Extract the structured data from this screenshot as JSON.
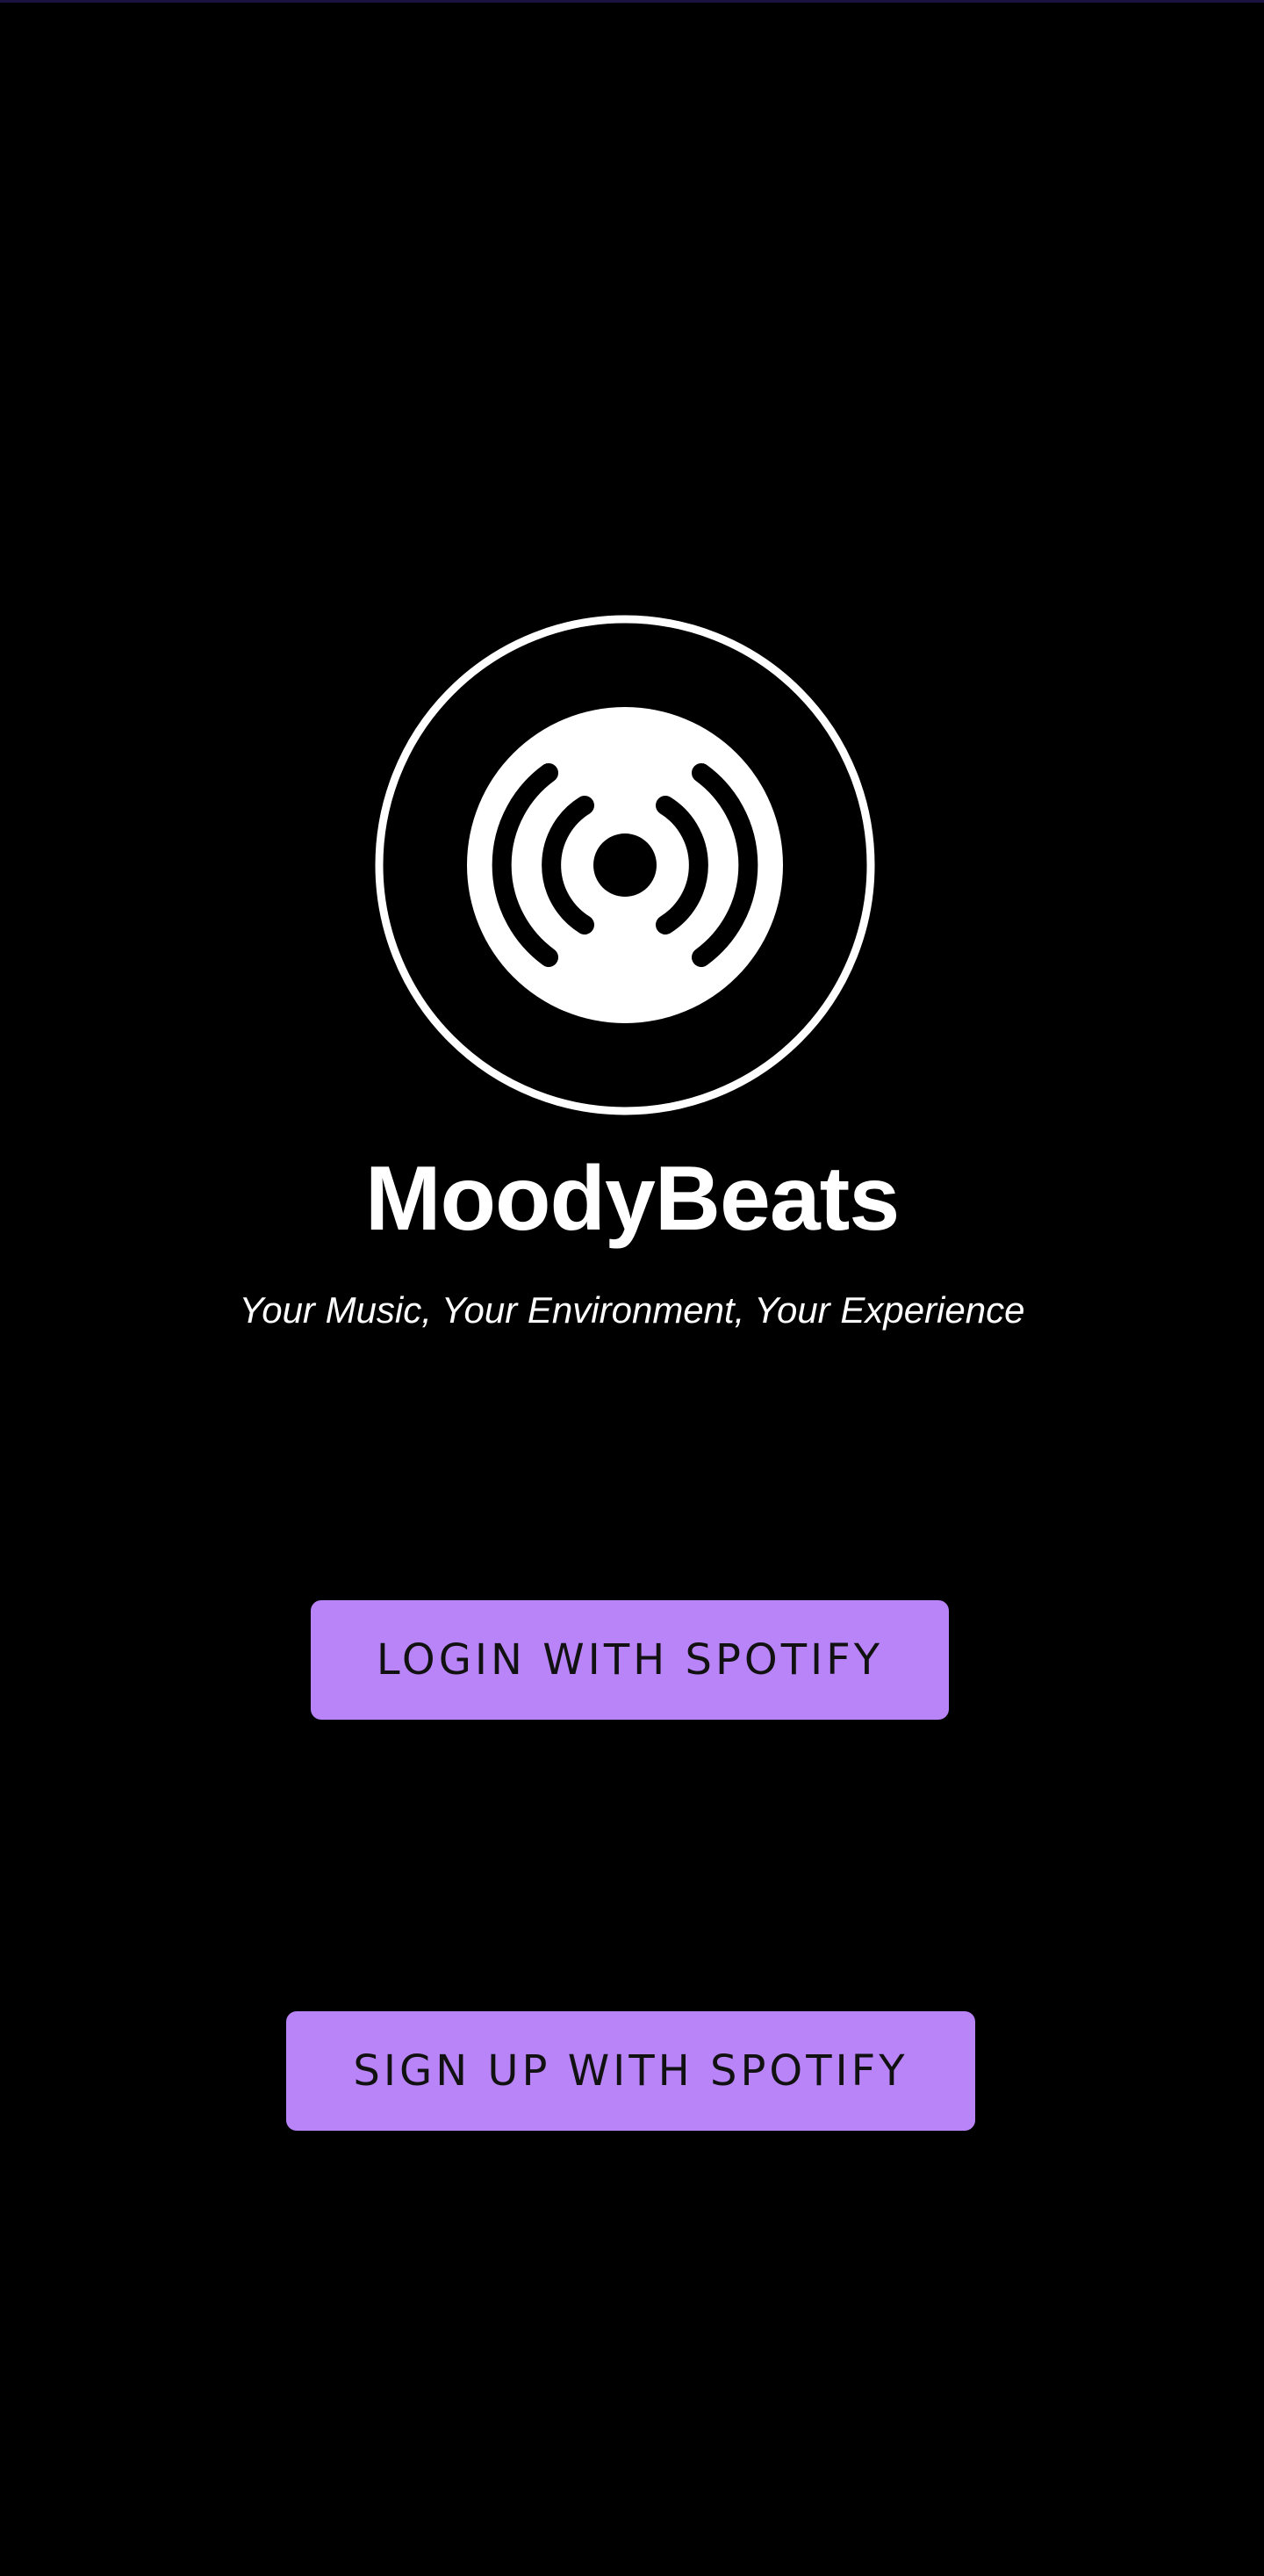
{
  "app": {
    "name": "MoodyBeats",
    "tagline": "Your Music, Your Environment, Your Experience",
    "logo_icon": "broadcast-disc-icon"
  },
  "actions": {
    "login_label": "LOGIN WITH SPOTIFY",
    "signup_label": "SIGN UP WITH SPOTIFY"
  },
  "colors": {
    "background": "#000000",
    "button": "#b884f8",
    "button_text": "#111111",
    "text": "#ffffff"
  }
}
